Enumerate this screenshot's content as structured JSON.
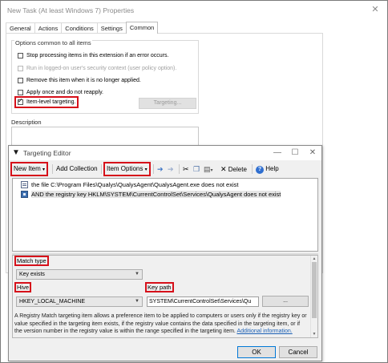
{
  "window": {
    "title": "New Task (At least Windows 7) Properties",
    "close_glyph": "✕",
    "tabs": [
      {
        "label": "General",
        "active": false
      },
      {
        "label": "Actions",
        "active": false
      },
      {
        "label": "Conditions",
        "active": false
      },
      {
        "label": "Settings",
        "active": false
      },
      {
        "label": "Common",
        "active": true
      }
    ]
  },
  "common": {
    "group_label": "Options common to all items",
    "options": [
      {
        "label": "Stop processing items in this extension if an error occurs.",
        "checked": false,
        "enabled": true
      },
      {
        "label": "Run in logged-on user's security context (user policy option).",
        "checked": false,
        "enabled": false
      },
      {
        "label": "Remove this item when it is no longer applied.",
        "checked": false,
        "enabled": true
      },
      {
        "label": "Apply once and do not reapply.",
        "checked": false,
        "enabled": true
      },
      {
        "label": "Item-level targeting.",
        "checked": true,
        "enabled": true
      }
    ],
    "targeting_button": "Targeting...",
    "description_label": "Description"
  },
  "targeting_editor": {
    "title": "Targeting Editor",
    "window_buttons": {
      "minimize": "—",
      "maximize": "☐",
      "close": "✕"
    },
    "toolbar": {
      "new_item": "New Item",
      "add_collection": "Add Collection",
      "item_options": "Item Options",
      "delete": "Delete",
      "help": "Help"
    },
    "items": [
      {
        "text": "the file C:\\Program Files\\Qualys\\QualysAgent\\QualysAgent.exe does not exist",
        "icon": "file-icon"
      },
      {
        "text": "AND the registry key HKLM\\SYSTEM\\CurrentControlSet\\Services\\QualysAgent does not exist",
        "icon": "registry-icon",
        "selected": true
      }
    ],
    "properties": {
      "match_type_label": "Match type",
      "match_type_value": "Key exists",
      "hive_label": "Hive",
      "hive_value": "HKEY_LOCAL_MACHINE",
      "key_path_label": "Key path",
      "key_path_value": "SYSTEM\\CurrentControlSet\\Services\\Qu",
      "browse_label": "...",
      "description": "A Registry Match targeting item allows a preference item to be applied to computers or users only if the registry key or value specified in the targeting item exists, if the registry value contains the data specified in the targeting item, or if the version number in the registry value is within the range specified in the targeting item.",
      "more_info_link": "Additional information."
    },
    "ok_label": "OK",
    "cancel_label": "Cancel"
  },
  "colors": {
    "highlight_red": "#d6101a",
    "link_blue": "#1a5fb4",
    "default_button_border": "#0078d7"
  }
}
